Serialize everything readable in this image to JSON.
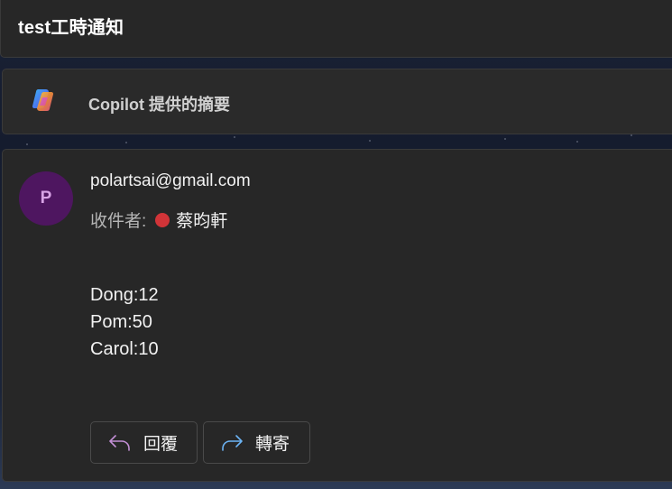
{
  "header": {
    "title": "test工時通知"
  },
  "copilot": {
    "summary_label": "Copilot 提供的摘要",
    "icon": "copilot-logo-icon"
  },
  "message": {
    "avatar_initial": "P",
    "sender": "polartsai@gmail.com",
    "recipient_label": "收件者:",
    "recipient_name": "蔡昀軒",
    "recipient_status_color": "#d13438",
    "body_lines": [
      "Dong:12",
      "Pom:50",
      "Carol:10"
    ],
    "actions": {
      "reply_label": "回覆",
      "forward_label": "轉寄"
    }
  },
  "colors": {
    "avatar_bg": "#4e1660",
    "reply_icon": "#c38fd6",
    "forward_icon": "#6cb4f5"
  }
}
